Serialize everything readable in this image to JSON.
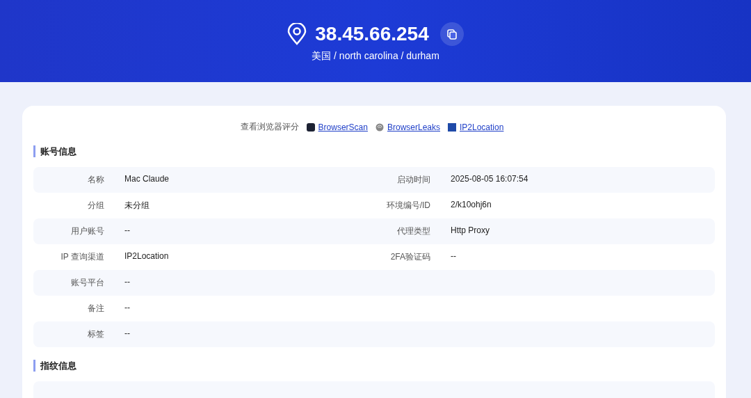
{
  "header": {
    "ip": "38.45.66.254",
    "location": "美国 / north carolina / durham"
  },
  "score_links": {
    "label": "查看浏览器评分",
    "links": [
      {
        "kind": "scan",
        "text": "BrowserScan"
      },
      {
        "kind": "leaks",
        "text": "BrowserLeaks"
      },
      {
        "kind": "ip2",
        "text": "IP2Location"
      }
    ]
  },
  "sections": [
    {
      "title": "账号信息",
      "rows": [
        {
          "cells": [
            {
              "label": "名称",
              "value": "Mac Claude"
            },
            {
              "label": "启动时间",
              "value": "2025-08-05 16:07:54"
            }
          ]
        },
        {
          "cells": [
            {
              "label": "分组",
              "value": "未分组"
            },
            {
              "label": "环境编号/ID",
              "value": "2/k10ohj6n"
            }
          ]
        },
        {
          "cells": [
            {
              "label": "用户账号",
              "value": "--"
            },
            {
              "label": "代理类型",
              "value": "Http Proxy"
            }
          ]
        },
        {
          "cells": [
            {
              "label": "IP 查询渠道",
              "value": "IP2Location"
            },
            {
              "label": "2FA验证码",
              "value": "--"
            }
          ]
        },
        {
          "cells": [
            {
              "label": "账号平台",
              "value": "--"
            }
          ]
        },
        {
          "cells": [
            {
              "label": "备注",
              "value": "--"
            }
          ]
        },
        {
          "cells": [
            {
              "label": "标签",
              "value": "--"
            }
          ]
        }
      ]
    },
    {
      "title": "指纹信息",
      "rows": [
        {
          "cells": []
        }
      ]
    }
  ]
}
